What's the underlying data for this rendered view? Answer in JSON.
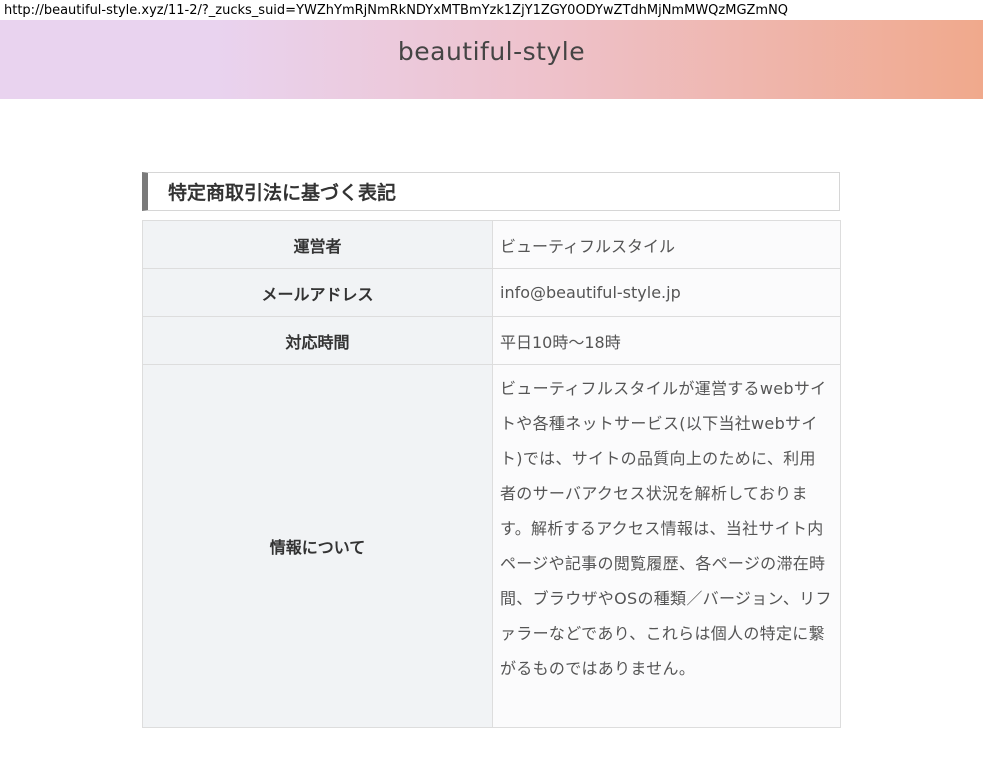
{
  "browser": {
    "url": "http://beautiful-style.xyz/11-2/?_zucks_suid=YWZhYmRjNmRkNDYxMTBmYzk1ZjY1ZGY0ODYwZTdhMjNmMWQzMGZmNQ"
  },
  "header": {
    "site_title": "beautiful-style"
  },
  "main": {
    "heading": "特定商取引法に基づく表記",
    "rows": [
      {
        "label": "運営者",
        "value": "ビューティフルスタイル"
      },
      {
        "label": "メールアドレス",
        "value": "info@beautiful-style.jp"
      },
      {
        "label": "対応時間",
        "value": "平日10時〜18時"
      },
      {
        "label": "情報について",
        "value": "ビューティフルスタイルが運営するwebサイトや各種ネットサービス(以下当社webサイト)では、サイトの品質向上のために、利用者のサーバアクセス状況を解析しております。解析するアクセス情報は、当社サイト内ページや記事の閲覧履歴、各ページの滞在時間、ブラウザやOSの種類／バージョン、リファラーなどであり、これらは個人の特定に繋がるものではありません。"
      }
    ]
  },
  "colors": {
    "header_gradient_start": "#e9d3ef",
    "header_gradient_end": "#f0a98c",
    "heading_accent": "#7a7a7a",
    "label_cell_bg": "#f1f3f5"
  }
}
